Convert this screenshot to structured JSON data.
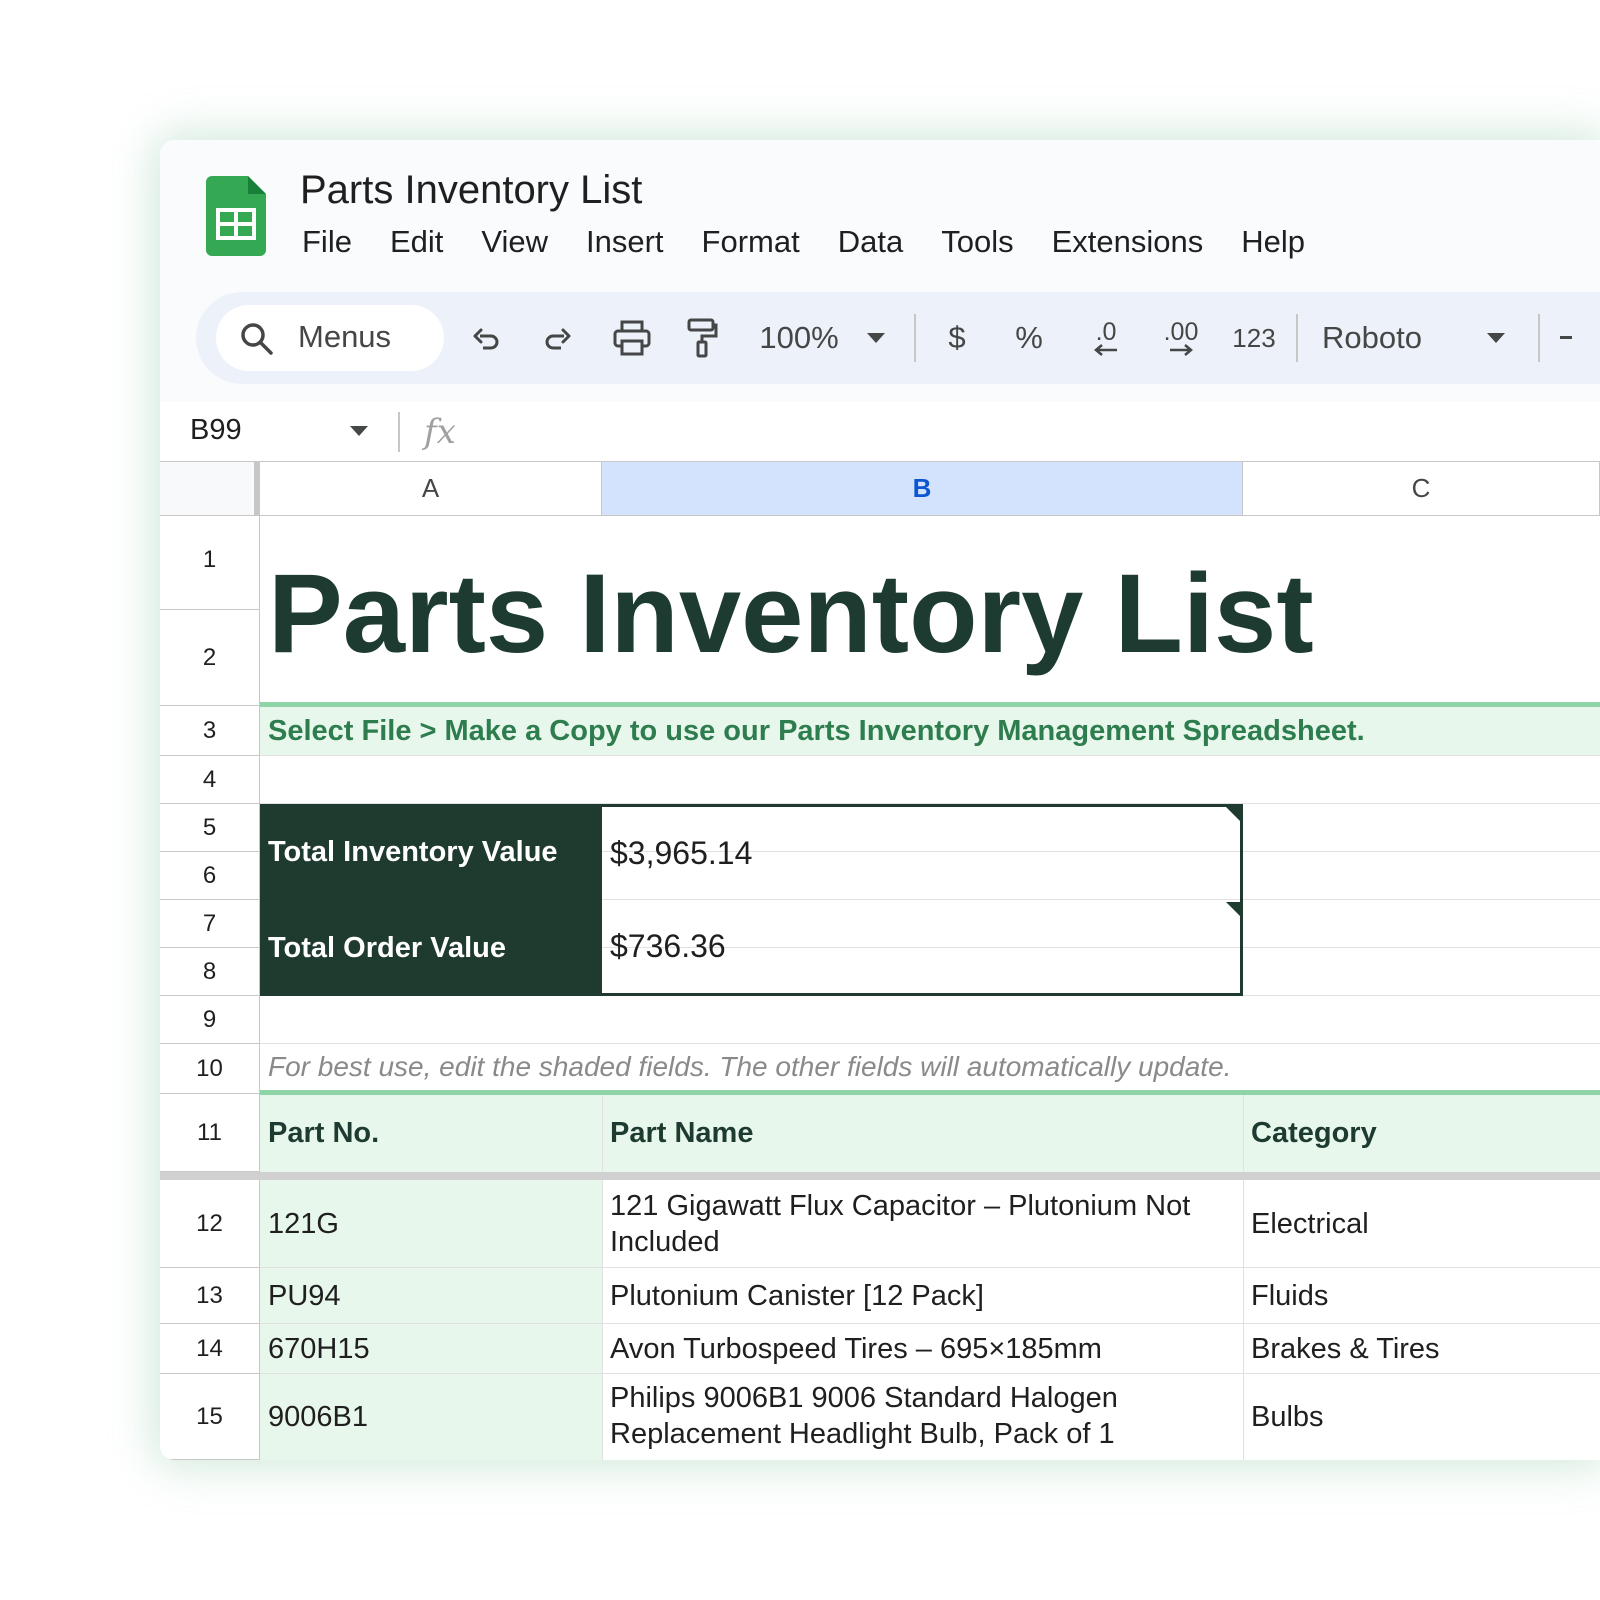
{
  "app": {
    "doc_title": "Parts Inventory List",
    "menus": [
      "File",
      "Edit",
      "View",
      "Insert",
      "Format",
      "Data",
      "Tools",
      "Extensions",
      "Help"
    ]
  },
  "toolbar": {
    "search_label": "Menus",
    "zoom": "100%",
    "currency": "$",
    "percent": "%",
    "decrease_decimal": ".0",
    "increase_decimal": ".00",
    "number_format": "123",
    "font": "Roboto"
  },
  "formula_bar": {
    "name_box": "B99",
    "fx_label": "fx"
  },
  "columns": [
    "A",
    "B",
    "C"
  ],
  "rows": [
    "1",
    "2",
    "3",
    "4",
    "5",
    "6",
    "7",
    "8",
    "9",
    "10",
    "11",
    "12",
    "13",
    "14",
    "15"
  ],
  "sheet": {
    "title": "Parts Inventory List",
    "instruction": "Select File > Make a Copy to use our Parts Inventory Management Spreadsheet.",
    "summary": [
      {
        "label": "Total Inventory Value",
        "value": "$3,965.14"
      },
      {
        "label": "Total Order Value",
        "value": "$736.36"
      }
    ],
    "note": "For best use, edit the shaded fields. The other fields will automatically update.",
    "headers": [
      "Part No.",
      "Part Name",
      "Category"
    ],
    "items": [
      {
        "part_no": "121G",
        "part_name": "121 Gigawatt Flux Capacitor – Plutonium Not Included",
        "category": "Electrical"
      },
      {
        "part_no": "PU94",
        "part_name": "Plutonium Canister [12 Pack]",
        "category": "Fluids"
      },
      {
        "part_no": "670H15",
        "part_name": "Avon Turbospeed Tires – 695×185mm",
        "category": "Brakes & Tires"
      },
      {
        "part_no": "9006B1",
        "part_name": "Philips 9006B1 9006 Standard Halogen Replacement Headlight Bulb, Pack of 1",
        "category": "Bulbs"
      }
    ]
  },
  "colors": {
    "brand_green": "#34a853",
    "dark_green": "#1f3a2f",
    "title_green": "#1e3b31",
    "instruction_green": "#2e7d4f",
    "shade_green": "#e8f7ec",
    "selected_col": "#d3e3fd"
  }
}
